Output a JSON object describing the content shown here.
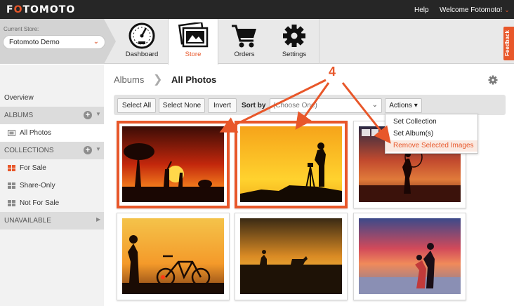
{
  "topbar": {
    "logo_prefix": "F",
    "logo_accent": "O",
    "logo_rest": "TOMOTO",
    "help": "Help",
    "welcome": "Welcome Fotomoto!",
    "welcome_chevron": "⌄"
  },
  "store": {
    "label": "Current Store:",
    "value": "Fotomoto Demo",
    "chevron": "⌄"
  },
  "nav": {
    "tabs": [
      {
        "label": "Dashboard",
        "icon": "gauge-icon"
      },
      {
        "label": "Store",
        "icon": "photos-icon",
        "active": true
      },
      {
        "label": "Orders",
        "icon": "cart-icon"
      },
      {
        "label": "Settings",
        "icon": "gear-icon"
      }
    ],
    "feedback": "Feedback"
  },
  "sidebar": {
    "overview": "Overview",
    "albums": "ALBUMS",
    "all_photos": "All Photos",
    "collections": "COLLECTIONS",
    "for_sale": "For Sale",
    "share_only": "Share-Only",
    "not_for_sale": "Not For Sale",
    "unavailable": "UNAVAILABLE",
    "plus": "+",
    "dd": "▼",
    "rt": "▶"
  },
  "main": {
    "breadcrumb_root": "Albums",
    "breadcrumb_sep": "❯",
    "breadcrumb_current": "All Photos"
  },
  "toolbar": {
    "select_all": "Select All",
    "select_none": "Select None",
    "invert": "Invert",
    "sort_by": "Sort by",
    "sort_placeholder": "(Choose One)",
    "sort_chevron": "⌄",
    "actions": "Actions ▾"
  },
  "actions_menu": {
    "items": [
      {
        "label": "Set Collection"
      },
      {
        "label": "Set Album(s)"
      },
      {
        "label": "Remove Selected Images",
        "highlighted": true
      }
    ]
  },
  "annotation": {
    "number": "4"
  },
  "photos": [
    {
      "name": "photo-safari-sunset",
      "selected": true
    },
    {
      "name": "photo-photographer-silhouette",
      "selected": true
    },
    {
      "name": "photo-dancer-sunset",
      "selected": false
    },
    {
      "name": "photo-bicycle-sunset",
      "selected": false
    },
    {
      "name": "photo-dog-runner",
      "selected": false
    },
    {
      "name": "photo-couple-beach",
      "selected": false
    }
  ],
  "colors": {
    "accent": "#e8572a",
    "topbar": "#262626",
    "highlight_bg": "#fae9e1"
  }
}
